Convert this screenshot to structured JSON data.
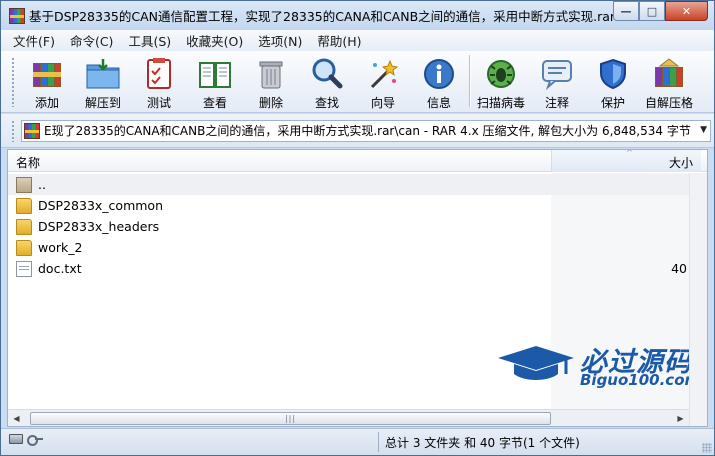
{
  "window": {
    "title": "基于DSP28335的CAN通信配置工程，实现了28335的CANA和CANB之间的通信，采用中断方式实现.rar - WinRAR",
    "controls": {
      "minimize": "—",
      "maximize": "□",
      "close": "✕"
    }
  },
  "menu": {
    "items": [
      "文件(F)",
      "命令(C)",
      "工具(S)",
      "收藏夹(O)",
      "选项(N)",
      "帮助(H)"
    ]
  },
  "toolbar": {
    "buttons": [
      {
        "label": "添加",
        "icon": "add-archive-icon"
      },
      {
        "label": "解压到",
        "icon": "extract-to-icon"
      },
      {
        "label": "测试",
        "icon": "test-icon"
      },
      {
        "label": "查看",
        "icon": "view-book-icon"
      },
      {
        "label": "删除",
        "icon": "delete-trash-icon"
      },
      {
        "label": "查找",
        "icon": "find-magnifier-icon"
      },
      {
        "label": "向导",
        "icon": "wizard-wand-icon"
      },
      {
        "label": "信息",
        "icon": "info-icon"
      },
      {
        "label": "扫描病毒",
        "icon": "virus-scan-icon"
      },
      {
        "label": "注释",
        "icon": "comment-icon"
      },
      {
        "label": "保护",
        "icon": "protect-shield-icon"
      },
      {
        "label": "自解压格",
        "icon": "sfx-icon"
      }
    ]
  },
  "address": {
    "path": "E现了28335的CANA和CANB之间的通信，采用中断方式实现.rar\\can - RAR 4.x 压缩文件, 解包大小为 6,848,534 字节"
  },
  "list": {
    "columns": {
      "name": "名称",
      "size": "大小"
    },
    "rows": [
      {
        "name": "..",
        "size": "",
        "type": "up"
      },
      {
        "name": "DSP2833x_common",
        "size": "",
        "type": "folder"
      },
      {
        "name": "DSP2833x_headers",
        "size": "",
        "type": "folder"
      },
      {
        "name": "work_2",
        "size": "",
        "type": "folder"
      },
      {
        "name": "doc.txt",
        "size": "40",
        "type": "file"
      }
    ]
  },
  "watermark": {
    "title": "必过源码",
    "subtitle": "Biguo100.com"
  },
  "status": {
    "summary": "总计 3 文件夹 和 40 字节(1 个文件)"
  },
  "colors": {
    "accent": "#1c5aa8",
    "chrome": "#c9dcf1"
  }
}
